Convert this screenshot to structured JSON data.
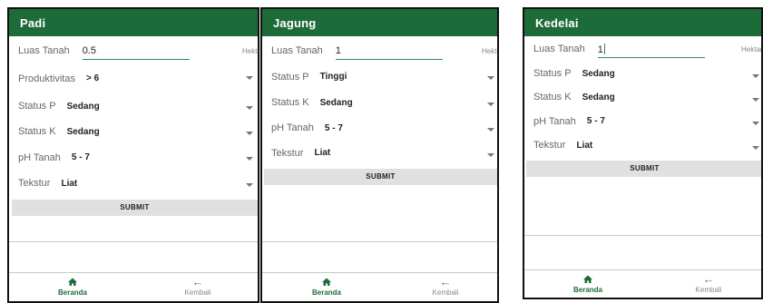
{
  "screens": [
    {
      "title": "Padi",
      "luas_label": "Luas Tanah",
      "luas_value": "0.5",
      "unit": "Hektar",
      "selects": [
        {
          "label": "Produktivitas",
          "value": "> 6"
        },
        {
          "label": "Status P",
          "value": "Sedang"
        },
        {
          "label": "Status K",
          "value": "Sedang"
        },
        {
          "label": "pH Tanah",
          "value": "5 - 7"
        },
        {
          "label": "Tekstur",
          "value": "Liat"
        }
      ],
      "submit": "SUBMIT",
      "nav": {
        "home": "Beranda",
        "back": "Kembali"
      }
    },
    {
      "title": "Jagung",
      "luas_label": "Luas Tanah",
      "luas_value": "1",
      "unit": "Hektar",
      "selects": [
        {
          "label": "Status P",
          "value": "Tinggi"
        },
        {
          "label": "Status K",
          "value": "Sedang"
        },
        {
          "label": "pH Tanah",
          "value": "5 - 7"
        },
        {
          "label": "Tekstur",
          "value": "Liat"
        }
      ],
      "submit": "SUBMIT",
      "nav": {
        "home": "Beranda",
        "back": "Kembali"
      }
    },
    {
      "title": "Kedelai",
      "luas_label": "Luas Tanah",
      "luas_value": "1",
      "unit": "Hektar",
      "selects": [
        {
          "label": "Status P",
          "value": "Sedang"
        },
        {
          "label": "Status K",
          "value": "Sedang"
        },
        {
          "label": "pH Tanah",
          "value": "5 - 7"
        },
        {
          "label": "Tekstur",
          "value": "Liat"
        }
      ],
      "submit": "SUBMIT",
      "nav": {
        "home": "Beranda",
        "back": "Kembali"
      }
    }
  ],
  "colors": {
    "appbar": "#1e6b3a",
    "accent": "#2f8f58",
    "submit_bg": "#e0e0e0"
  },
  "icons": {
    "home": "home-icon",
    "back": "arrow-left-icon"
  }
}
